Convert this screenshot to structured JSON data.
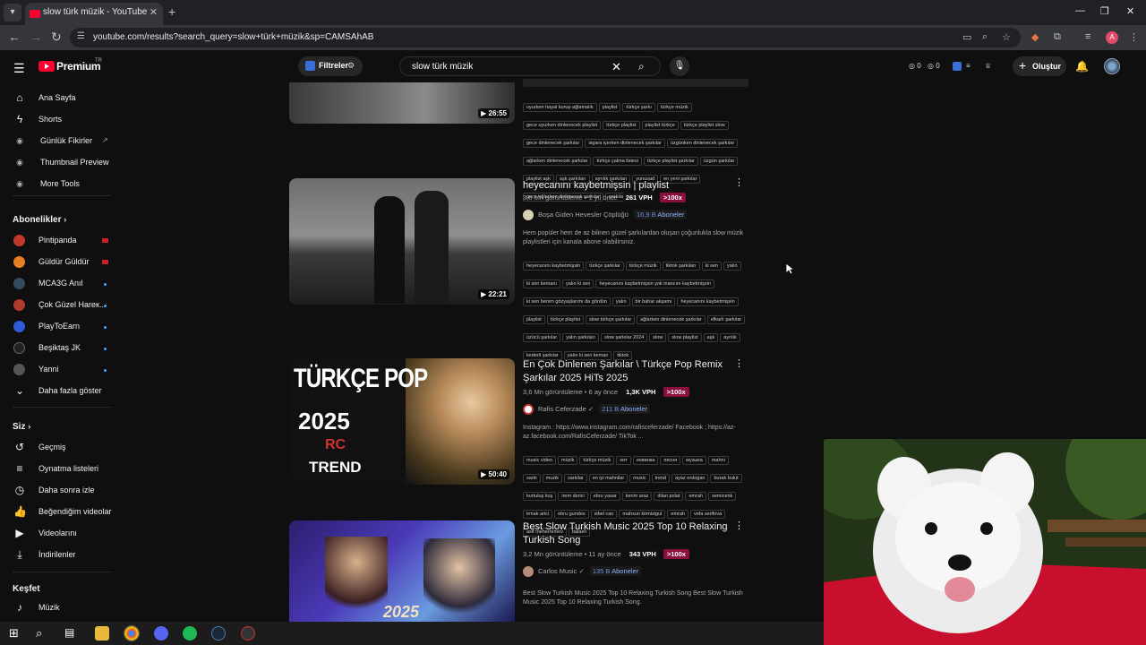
{
  "browser": {
    "tab_title": "slow türk müzik - YouTube",
    "url": "youtube.com/results?search_query=slow+türk+müzik&sp=CAMSAhAB",
    "profile_letter": "A"
  },
  "header": {
    "premium_label": "Premium",
    "region": "TR",
    "filter_label": "Filtreler",
    "search_value": "slow türk müzik",
    "counter_a": "0",
    "counter_b": "0",
    "create_label": "Oluştur"
  },
  "sidebar": {
    "main": [
      {
        "label": "Ana Sayfa",
        "icon": "home-icon"
      },
      {
        "label": "Shorts",
        "icon": "shorts-icon"
      },
      {
        "label": "Günlük Fikirler",
        "icon": "extension-icon"
      },
      {
        "label": "Thumbnail Preview",
        "icon": "extension-icon"
      },
      {
        "label": "More Tools",
        "icon": "extension-icon"
      }
    ],
    "subscriptions_title": "Abonelikler",
    "subscriptions": [
      {
        "label": "Pintipanda",
        "color": "#c0392b"
      },
      {
        "label": "Güldür Güldür",
        "color": "#e67e22"
      },
      {
        "label": "MCA3G Anıl",
        "color": "#34495e"
      },
      {
        "label": "Çok Güzel Hareк...",
        "color": "#b03a2e"
      },
      {
        "label": "PlayToEarn",
        "color": "#2e5bd8"
      },
      {
        "label": "Beşiktaş JK",
        "color": "#222222"
      },
      {
        "label": "Yanni",
        "color": "#555555"
      }
    ],
    "show_more": "Daha fazla göster",
    "you_title": "Siz",
    "you": [
      {
        "label": "Geçmiş",
        "icon": "history-icon"
      },
      {
        "label": "Oynatma listeleri",
        "icon": "playlist-icon"
      },
      {
        "label": "Daha sonra izle",
        "icon": "clock-icon"
      },
      {
        "label": "Beğendiğim videolar",
        "icon": "like-icon"
      },
      {
        "label": "Videolarını",
        "icon": "video-icon"
      },
      {
        "label": "İndirilenler",
        "icon": "download-icon"
      }
    ],
    "explore_title": "Keşfet",
    "explore": [
      {
        "label": "Müzik",
        "icon": "music-icon"
      }
    ]
  },
  "results": [
    {
      "duration": "26:55",
      "tags": [
        "uyurken hayal kurup ağlamalık",
        "playlist",
        "türkçe şarkı",
        "türkçe müzik",
        "gece uyurken dinlenecek playlist",
        "türkçe playlist",
        "playlist türkçe",
        "türkçe playlist slow",
        "gece dinlenecek şarkılar",
        "sigara içerken dinlenecek şarkılar",
        "üzgünken dinlenecek şarkılar",
        "ağlarken dinlenecek şarkılar",
        "türkçe çalma listesi",
        "türkçe playlist şarkılar",
        "üzgün şarkılar",
        "playlist aşk",
        "aşk şarkıları",
        "ayrılık şarkıları",
        "yunusad",
        "en yeni şarkılar",
        "gece ağlarken dinlenecek şarkılar",
        "şarkılar",
        "müzik"
      ]
    },
    {
      "title": "heyecanını kaybetmişsin | playlist",
      "views": "3,6 Mn görüntüleme • 1 yıl önce",
      "vph": "261 VPH",
      "pct": ">100x",
      "channel": "Boşa Giden Hevesler Çöplüğü",
      "subs_num": "16,9 B",
      "subs_label": "Aboneler",
      "desc": "Hem popüler hem de az bilinen güzel şarkılardan oluşan çoğunlukla slow müzik playlistleri için kanala abone olabilirsiniz.",
      "duration": "22:21",
      "tags": [
        "heyecanını kaybetmişsin",
        "türkçe şarkılar",
        "türkçe müzik",
        "tiktok şarkıları",
        "ki sen",
        "yalın",
        "ki sen kemanı",
        "yalın ki sen",
        "heyecanını kaybetmişsin yok inancını kaybetmişsin",
        "ki sen benim gözyaşlarımı da gördün",
        "yalın",
        "bir bahar akşamı",
        "heyecanını kaybetmişsin",
        "playlist",
        "türkçe playlist",
        "slow türkçe şarkılar",
        "ağlarken dinlenecek şarkılar",
        "efkarlı şarkılar",
        "üzücü şarkılar",
        "yalın şarkıları",
        "slow şarkılar 2024",
        "slow",
        "slow playlist",
        "aşk",
        "ayrılık",
        "kederli şarkılar",
        "yalın ki sen keman",
        "tiktok"
      ]
    },
    {
      "title": "En Çok Dinlenen Şarkılar \\ Türkçe Pop Remix Şarkılar 2025 HiTs 2025",
      "views": "3,6 Mn görüntüleme • 6 ay önce",
      "vph": "1,3K VPH",
      "pct": ">100x",
      "channel": "Rafis Ceferzade",
      "subs_num": "211 B",
      "subs_label": "Aboneler",
      "desc": "Instagram : https://www.instagram.com/rafisceferzade/ Facebook ; https://az-az.facebook.com/RafisCeferzade/ TikTok ...",
      "duration": "50:40",
      "thumb_line1": "TÜRKÇE POP",
      "thumb_line2": "2025",
      "thumb_logo": "RC",
      "thumb_line3": "TREND",
      "tags": [
        "music video",
        "müzik",
        "türkçe müzik",
        "хит",
        "новинка",
        "песня",
        "музыка",
        "mahni",
        "sarki",
        "muzik",
        "sarkilar",
        "en iyi mahnilar",
        "music",
        "trend",
        "ayaz erdogan",
        "burak bulut",
        "kurtuluş kuş",
        "irem derici",
        "ebru yasar",
        "kerim araz",
        "dilan polat",
        "emrah",
        "semicenk",
        "irmak arici",
        "ebru gundes",
        "sibel can",
        "mahsun kirmizigul",
        "emrah",
        "vefa serifova",
        "asif meherremov",
        "balaeli"
      ]
    },
    {
      "title": "Best Slow Turkish Music 2025 Top 10 Relaxing Turkish Song",
      "views": "3,2 Mn görüntüleme • 11 ay önce",
      "vph": "343 VPH",
      "pct": ">100x",
      "channel": "Carlos Music",
      "subs_num": "135 B",
      "subs_label": "Aboneler",
      "desc": "Best Slow Turkish Music 2025 Top 10 Relaxing Turkish Song Best Slow Turkish Music 2025 Top 10 Relaxing Turkish Song.",
      "thumb_line2": "2025"
    }
  ],
  "colors": {
    "background": "#0f0f0f",
    "brand_red": "#ff0033",
    "pct_badge": "#8a0f3e",
    "subs_text": "#8fb3ff"
  }
}
